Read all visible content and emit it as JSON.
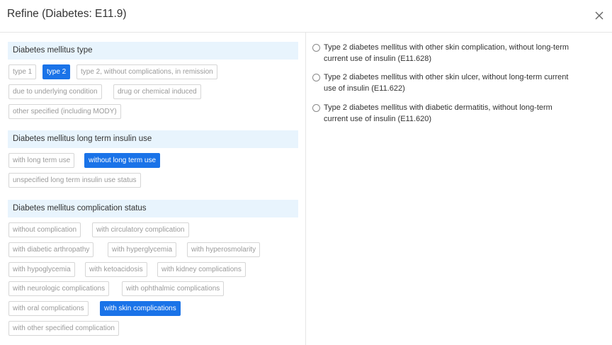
{
  "dialog": {
    "title": "Refine (Diabetes: E11.9)",
    "close_icon": "close-icon"
  },
  "sections": [
    {
      "heading": "Diabetes mellitus type",
      "chips": [
        {
          "label": "type 1",
          "selected": false
        },
        {
          "label": "type 2",
          "selected": true
        },
        {
          "label": "type 2, without complications, in remission",
          "selected": false
        },
        {
          "label": "due to underlying condition",
          "selected": false
        },
        {
          "label": "drug or chemical induced",
          "selected": false
        },
        {
          "label": "other specified (including MODY)",
          "selected": false
        }
      ]
    },
    {
      "heading": "Diabetes mellitus long term insulin use",
      "chips": [
        {
          "label": "with long term use",
          "selected": false
        },
        {
          "label": "without long term use",
          "selected": true
        },
        {
          "label": "unspecified long term insulin use status",
          "selected": false
        }
      ]
    },
    {
      "heading": "Diabetes mellitus complication status",
      "chips": [
        {
          "label": "without complication",
          "selected": false
        },
        {
          "label": "with circulatory complication",
          "selected": false
        },
        {
          "label": "with diabetic arthropathy",
          "selected": false
        },
        {
          "label": "with hyperglycemia",
          "selected": false
        },
        {
          "label": "with hyperosmolarity",
          "selected": false
        },
        {
          "label": "with hypoglycemia",
          "selected": false
        },
        {
          "label": "with ketoacidosis",
          "selected": false
        },
        {
          "label": "with kidney complications",
          "selected": false
        },
        {
          "label": "with neurologic complications",
          "selected": false
        },
        {
          "label": "with ophthalmic complications",
          "selected": false
        },
        {
          "label": "with oral complications",
          "selected": false
        },
        {
          "label": "with skin complications",
          "selected": true
        },
        {
          "label": "with other specified complication",
          "selected": false
        }
      ]
    }
  ],
  "results": [
    {
      "line1": "Type 2 diabetes mellitus with other skin complication, without long-term",
      "line2": "current use of insulin (E11.628)",
      "selected": false
    },
    {
      "line1": "Type 2 diabetes mellitus with other skin ulcer, without long-term current",
      "line2": "use of insulin (E11.622)",
      "selected": false
    },
    {
      "line1": "Type 2 diabetes mellitus with diabetic dermatitis, without long-term",
      "line2": "current use of insulin (E11.620)",
      "selected": false
    }
  ],
  "colors": {
    "accent": "#1a73e8",
    "section_background": "#e8f4fd",
    "chip_border": "#d6d6d6",
    "chip_text": "#9a9a9a"
  }
}
